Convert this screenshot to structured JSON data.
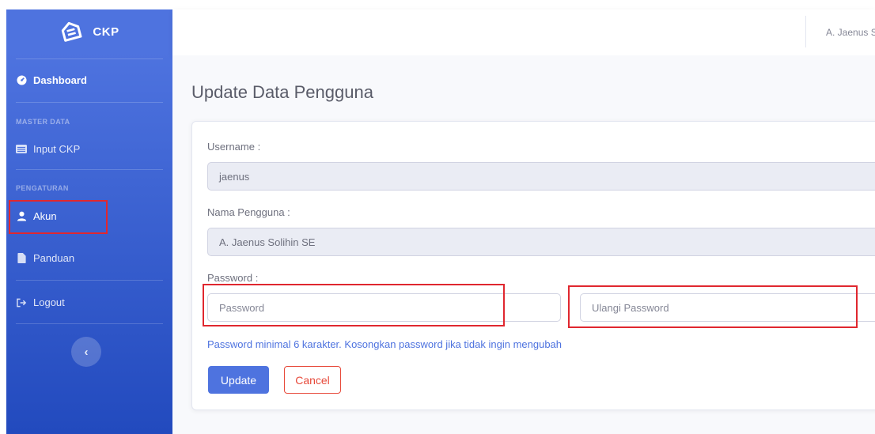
{
  "brand": {
    "name": "CKP",
    "icon": "envelope-open-icon"
  },
  "sidebar": {
    "dashboard": {
      "label": "Dashboard",
      "icon": "tachometer-icon"
    },
    "heading_master": "MASTER DATA",
    "input_ckp": {
      "label": "Input CKP",
      "icon": "list-icon"
    },
    "heading_settings": "PENGATURAN",
    "akun": {
      "label": "Akun",
      "icon": "user-icon"
    },
    "panduan": {
      "label": "Panduan",
      "icon": "file-icon"
    },
    "logout": {
      "label": "Logout",
      "icon": "sign-out-icon"
    },
    "toggle": "‹"
  },
  "topbar": {
    "user_name": "A. Jaenus Solihin SE"
  },
  "page": {
    "title": "Update Data Pengguna"
  },
  "form": {
    "username_label": "Username :",
    "username_value": "jaenus",
    "nama_label": "Nama Pengguna :",
    "nama_value": "A. Jaenus Solihin SE",
    "password_label": "Password :",
    "password_placeholder": "Password",
    "repeat_password_placeholder": "Ulangi Password",
    "hint": "Password minimal 6 karakter. Kosongkan password jika tidak ingin mengubah",
    "update_label": "Update",
    "cancel_label": "Cancel"
  },
  "colors": {
    "sidebar_start": "#4e73df",
    "sidebar_end": "#224abe",
    "primary": "#4e73df",
    "danger": "#e74a3b",
    "highlight": "#e0272f"
  }
}
